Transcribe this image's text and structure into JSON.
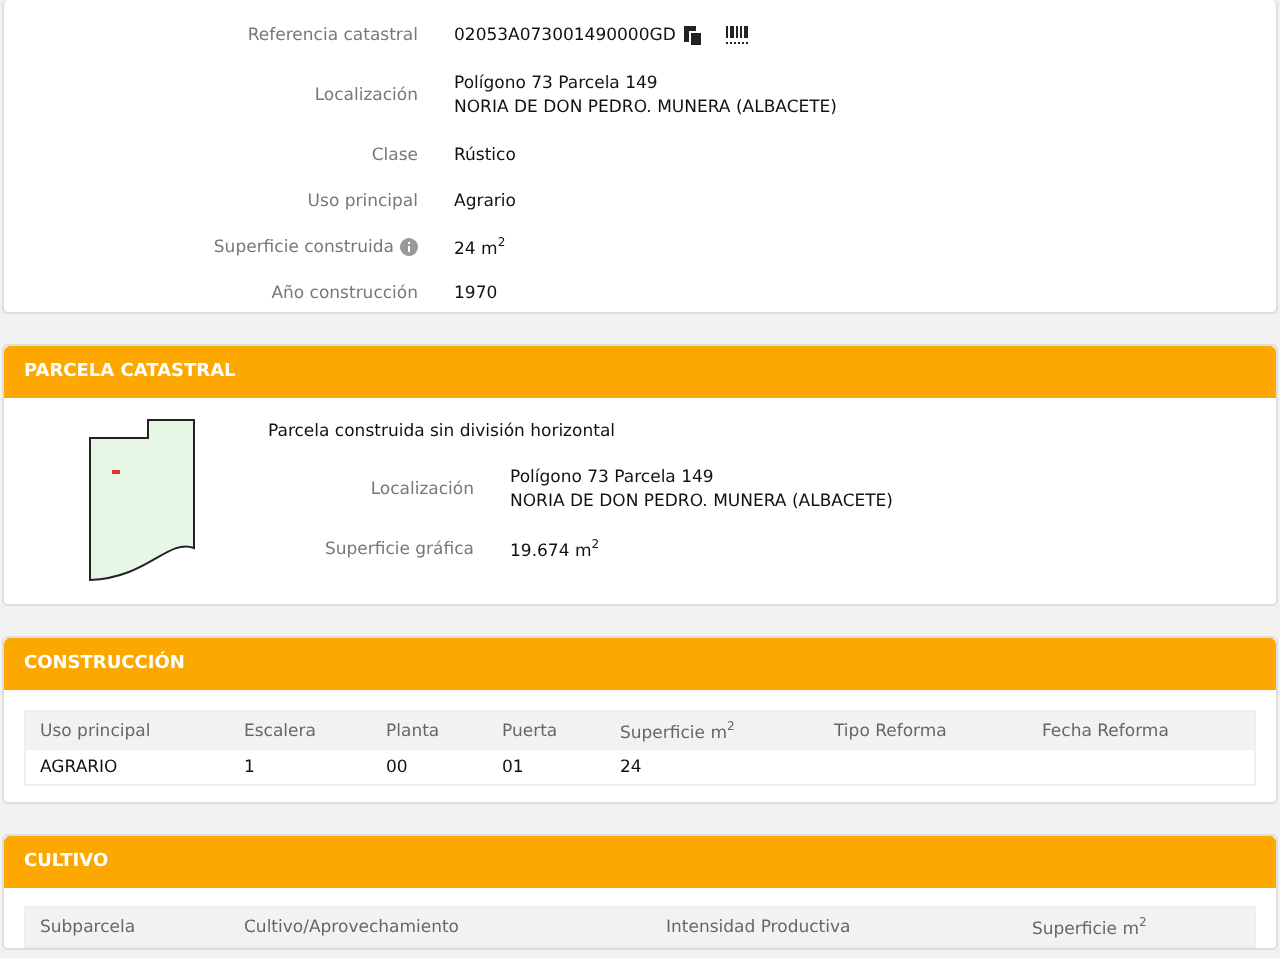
{
  "inmueble": {
    "fields": [
      {
        "label": "Referencia catastral",
        "lines": [
          "02053A073001490000GD"
        ],
        "kind": "reference"
      },
      {
        "label": "Localización",
        "lines": [
          "Polígono 73 Parcela 149",
          "NORIA DE DON PEDRO. MUNERA (ALBACETE)"
        ],
        "kind": "plain"
      },
      {
        "label": "Clase",
        "lines": [
          "Rústico"
        ],
        "kind": "plain"
      },
      {
        "label": "Uso principal",
        "lines": [
          "Agrario"
        ],
        "kind": "plain"
      },
      {
        "label": "Superficie construida",
        "lines": [
          "24 m$^{2}$"
        ],
        "kind": "info"
      },
      {
        "label": "Año construcción",
        "lines": [
          "1970"
        ],
        "kind": "plain"
      }
    ]
  },
  "parcela": {
    "title": "PARCELA CATASTRAL",
    "subtitle": "Parcela construida sin división horizontal",
    "fields": [
      {
        "label": "Localización",
        "lines": [
          "Polígono 73 Parcela 149",
          "NORIA DE DON PEDRO. MUNERA (ALBACETE)"
        ]
      },
      {
        "label": "Superficie gráfica",
        "lines": [
          "19.674 m$^{2}$"
        ]
      }
    ]
  },
  "construccion": {
    "title": "CONSTRUCCIÓN",
    "columns": [
      "Uso principal",
      "Escalera",
      "Planta",
      "Puerta",
      "Superficie m$^{2}$",
      "Tipo Reforma",
      "Fecha Reforma"
    ],
    "rows": [
      [
        "AGRARIO",
        "1",
        "00",
        "01",
        "24",
        "",
        ""
      ]
    ]
  },
  "cultivo": {
    "title": "CULTIVO",
    "columns": [
      "Subparcela",
      "Cultivo/Aprovechamiento",
      "Intensidad Productiva",
      "Superficie m$^{2}$"
    ]
  }
}
